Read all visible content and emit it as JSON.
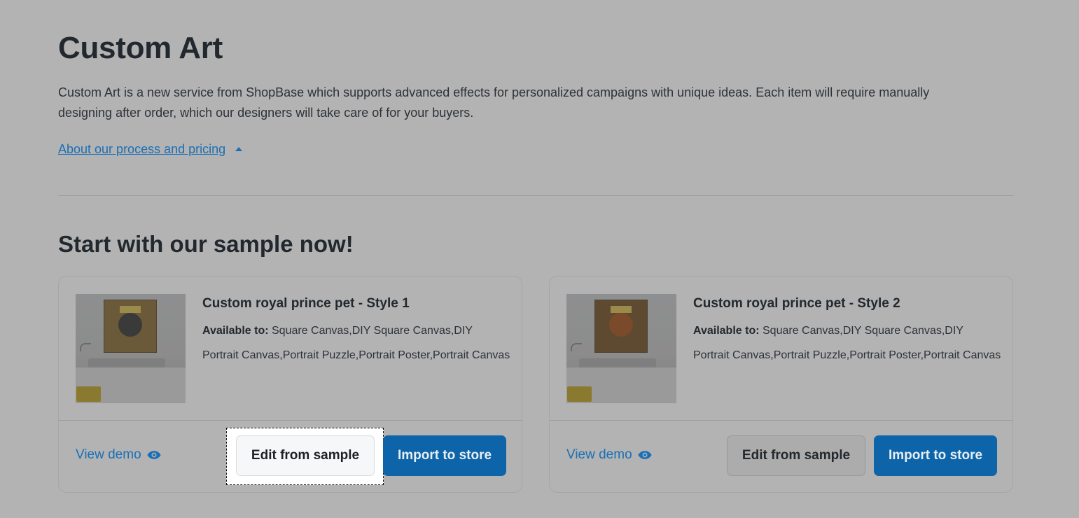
{
  "header": {
    "title": "Custom Art",
    "description": "Custom Art is a new service from ShopBase which supports advanced effects for personalized campaigns with unique ideas. Each item will require manually designing after order, which our designers will take care of for your buyers.",
    "about_link": "About our process and pricing"
  },
  "samples": {
    "heading": "Start with our sample now!",
    "cards": [
      {
        "title": "Custom royal prince pet - Style 1",
        "available_label": "Available to:",
        "available_value": "Square Canvas,DIY Square Canvas,DIY Portrait Canvas,Portrait Puzzle,Portrait Poster,Portrait Canvas",
        "view_demo": "View demo",
        "edit_label": "Edit from sample",
        "import_label": "Import to store"
      },
      {
        "title": "Custom royal prince pet - Style 2",
        "available_label": "Available to:",
        "available_value": "Square Canvas,DIY Square Canvas,DIY Portrait Canvas,Portrait Puzzle,Portrait Poster,Portrait Canvas",
        "view_demo": "View demo",
        "edit_label": "Edit from sample",
        "import_label": "Import to store"
      }
    ]
  },
  "colors": {
    "background": "#b3b3b3",
    "link": "#1b6fb5",
    "primary_button": "#0e64a8"
  },
  "icons": {
    "about_toggle": "caret-up-icon",
    "view_demo": "eye-icon"
  }
}
